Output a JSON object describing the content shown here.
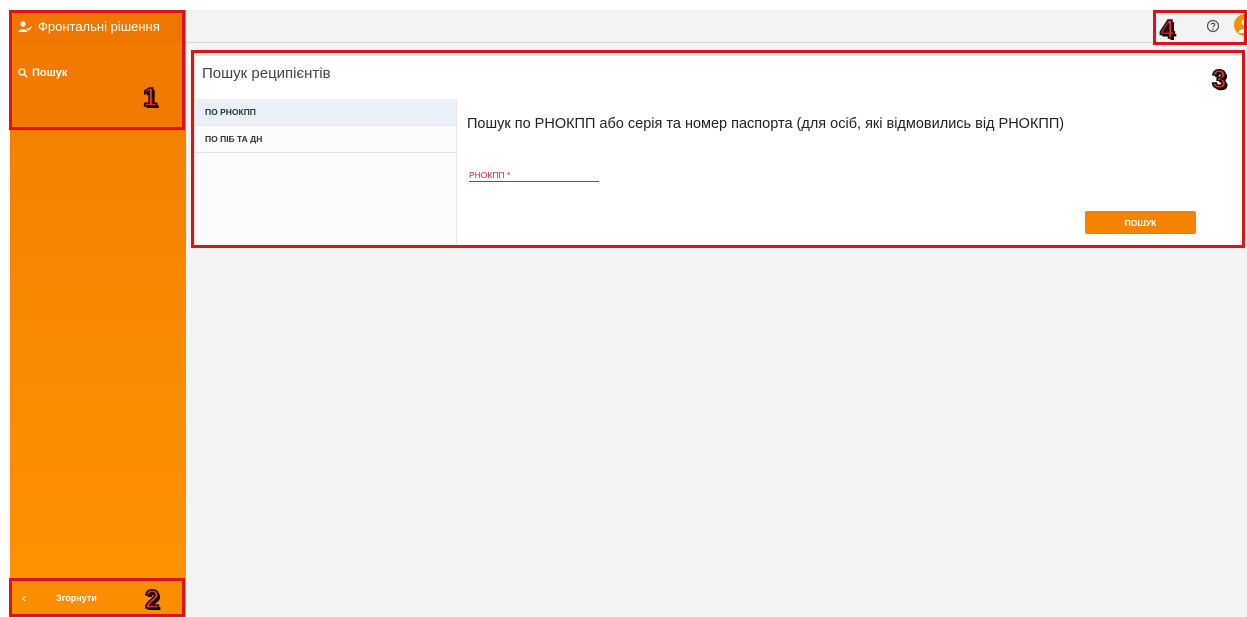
{
  "sidebar": {
    "app_title": "Фронтальні рішення",
    "nav_items": [
      {
        "label": "Пошук",
        "icon": "search-icon"
      }
    ],
    "collapse_label": "Згорнути"
  },
  "topbar": {
    "help_icon": "help-circle-icon",
    "user_icon": "user-avatar-icon"
  },
  "main": {
    "page_title": "Пошук реципієнтів",
    "tabs": [
      {
        "label": "ПО РНОКПП",
        "active": true
      },
      {
        "label": "ПО ПІБ ТА ДН",
        "active": false
      }
    ],
    "form": {
      "heading": "Пошук по РНОКПП або серія та номер паспорта (для осіб, які відмовились від РНОКПП)",
      "field_label": "РНОКПП *",
      "field_value": "",
      "search_button": "ПОШУК"
    }
  },
  "annotations": {
    "n1": "1",
    "n2": "2",
    "n3": "3",
    "n4": "4"
  },
  "colors": {
    "brand_orange": "#F68300",
    "annotation_red": "#D9141C",
    "error_red": "#D9262C"
  }
}
